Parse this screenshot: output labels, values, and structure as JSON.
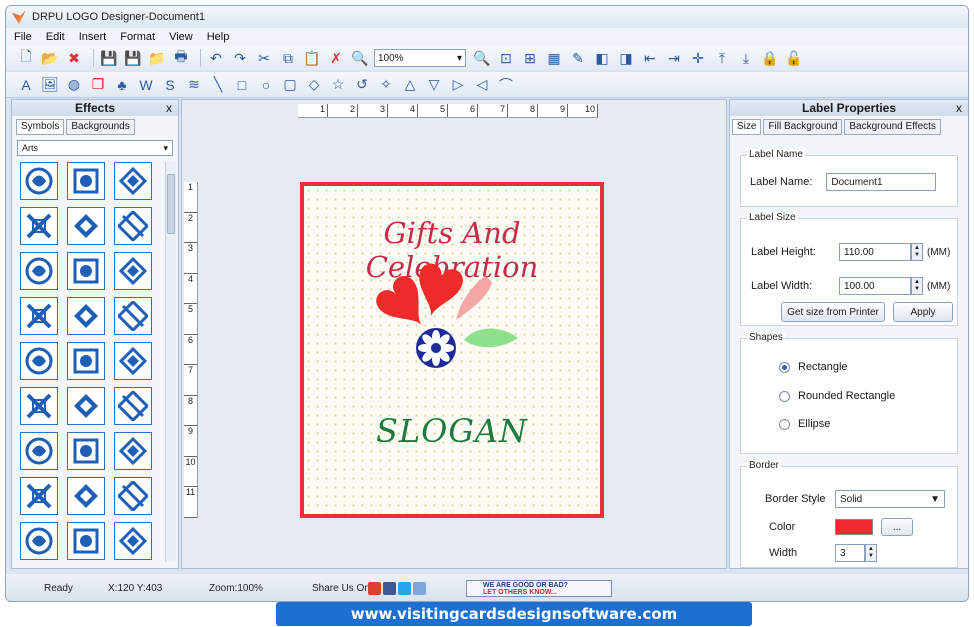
{
  "window": {
    "title": "DRPU LOGO Designer-Document1"
  },
  "menu": [
    "File",
    "Edit",
    "Insert",
    "Format",
    "View",
    "Help"
  ],
  "toolbar": {
    "zoom_value": "100%"
  },
  "effects_panel": {
    "title": "Effects",
    "close_label": "x",
    "tabs": [
      "Symbols",
      "Backgrounds"
    ],
    "category": "Arts"
  },
  "ruler": {
    "top": [
      "1",
      "2",
      "3",
      "4",
      "5",
      "6",
      "7",
      "8",
      "9",
      "10"
    ],
    "left": [
      "1",
      "2",
      "3",
      "4",
      "5",
      "6",
      "7",
      "8",
      "9",
      "10",
      "11"
    ]
  },
  "canvas": {
    "title": "Gifts And Celebration",
    "slogan": "SLOGAN",
    "border_color": "#e8303a"
  },
  "properties": {
    "title": "Label Properties",
    "close_label": "x",
    "tabs": [
      "Size",
      "Fill Background",
      "Background Effects"
    ],
    "label_name_group": "Label Name",
    "label_name_caption": "Label Name:",
    "label_name_value": "Document1",
    "label_size_group": "Label Size",
    "label_height_caption": "Label Height:",
    "label_height_value": "110.00",
    "label_width_caption": "Label Width:",
    "label_width_value": "100.00",
    "unit": "(MM)",
    "printer_button": "Get size from Printer",
    "apply_button": "Apply",
    "shapes_group": "Shapes",
    "shapes": [
      "Rectangle",
      "Rounded Rectangle",
      "Ellipse"
    ],
    "selected_shape": "Rectangle",
    "border_group": "Border",
    "border_style_caption": "Border Style",
    "border_style_value": "Solid",
    "color_caption": "Color",
    "color_value": "#f3282e",
    "color_button": "...",
    "width_caption": "Width",
    "width_value": "3"
  },
  "status": {
    "ready": "Ready",
    "coords": "X:120  Y:403",
    "zoom": "Zoom:100%",
    "share": "Share Us On:",
    "feedback_line1": "WE ARE GOOD OR BAD?",
    "feedback_line2": "LET OTHERS KNOW..."
  },
  "footer": {
    "url": "www.visitingcardsdesignsoftware.com"
  }
}
